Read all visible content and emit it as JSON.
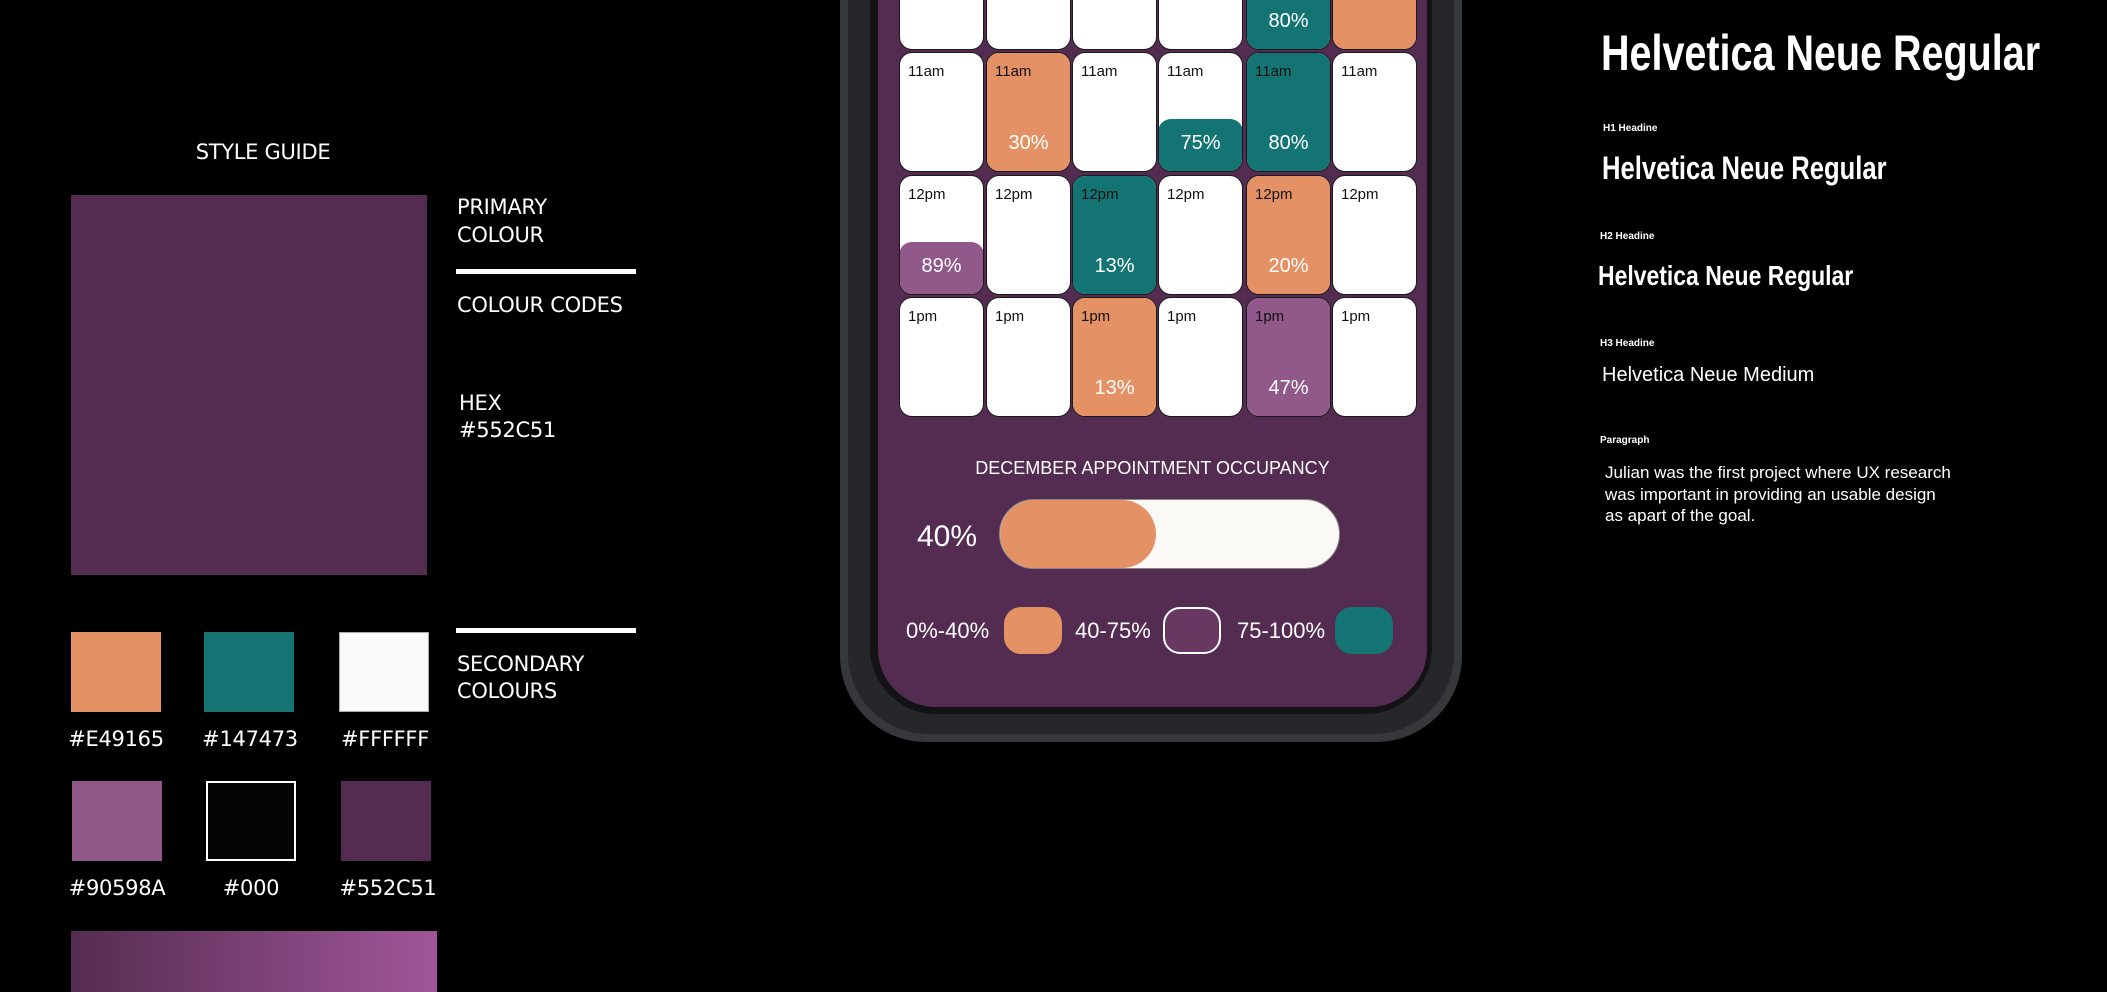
{
  "style_guide": {
    "title": "STYLE GUIDE",
    "primary_label_1": "PRIMARY",
    "primary_label_2": "COLOUR",
    "colour_codes_label": "COLOUR CODES",
    "hex_label": "HEX",
    "hex_value": "#552C51",
    "primary_color": "#552C51",
    "secondary_label_1": "SECONDARY",
    "secondary_label_2": "COLOURS",
    "swatches": [
      {
        "label": "#E49165",
        "color": "#E49165"
      },
      {
        "label": "#147473",
        "color": "#147473"
      },
      {
        "label": "#FFFFFF",
        "color": "#FFFFFF"
      },
      {
        "label": "#90598A",
        "color": "#90598A"
      },
      {
        "label": "#000",
        "color": "#000000"
      },
      {
        "label": "#552C51",
        "color": "#552C51"
      }
    ],
    "gradient": [
      "#552C51",
      "#A0569A"
    ]
  },
  "phone": {
    "grid": [
      {
        "time": "",
        "cells": [
          {},
          {},
          {},
          {},
          {
            "fill": "teal",
            "block": "full",
            "pct": "80%"
          },
          {
            "fill": "orange",
            "block": "full",
            "pct": ""
          }
        ]
      },
      {
        "time": "11am",
        "cells": [
          {},
          {
            "fill": "orange",
            "block": "full",
            "pct": "30%"
          },
          {},
          {
            "fill": "teal",
            "block": "bottom",
            "pct": "75%"
          },
          {
            "fill": "teal",
            "block": "full",
            "pct": "80%"
          },
          {}
        ]
      },
      {
        "time": "12pm",
        "cells": [
          {
            "fill": "purple",
            "block": "bottom",
            "pct": "89%"
          },
          {},
          {
            "fill": "teal",
            "block": "full",
            "pct": "13%"
          },
          {},
          {
            "fill": "orange",
            "block": "full",
            "pct": "20%"
          },
          {}
        ]
      },
      {
        "time": "1pm",
        "cells": [
          {},
          {},
          {
            "fill": "orange",
            "block": "full",
            "pct": "13%"
          },
          {},
          {
            "fill": "purple",
            "block": "full",
            "pct": "47%"
          },
          {}
        ]
      }
    ],
    "colors": {
      "orange": "#E49165",
      "teal": "#147473",
      "purple": "#90598A"
    },
    "occupancy_title": "DECEMBER APPOINTMENT OCCUPANCY",
    "occupancy_value": "40%",
    "occupancy_percent": 40,
    "legend": [
      {
        "label": "0%-40%",
        "color": "#E49165"
      },
      {
        "label": "40-75%",
        "color": "#683762"
      },
      {
        "label": "75-100%",
        "color": "#147473"
      }
    ]
  },
  "typography": {
    "title": "Helvetica Neue Regular",
    "h1_label": "H1 Headine",
    "h1_sample": "Helvetica Neue Regular",
    "h2_label": "H2 Headine",
    "h2_sample": "Helvetica Neue Regular",
    "h3_label": "H3 Headine",
    "h3_sample": "Helvetica Neue Medium",
    "paragraph_label": "Paragraph",
    "paragraph_lines": [
      "Julian was the first project where UX research",
      "was important in providing an usable design",
      "as apart of the goal."
    ]
  }
}
